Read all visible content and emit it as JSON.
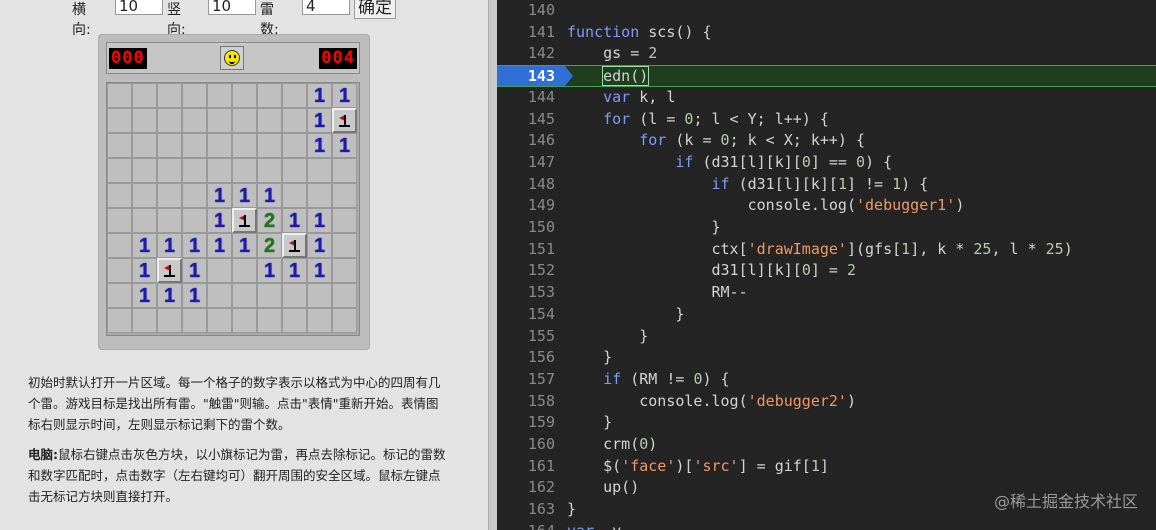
{
  "settings": {
    "width_label": "横向:",
    "width_value": "10",
    "height_label": "竖向:",
    "height_value": "10",
    "mines_label": "雷数:",
    "mines_value": "4",
    "confirm_label": "确定"
  },
  "game": {
    "mines_left": "000",
    "timer": "004",
    "grid": [
      [
        "",
        "",
        "",
        "",
        "",
        "",
        "",
        "",
        "1",
        "1"
      ],
      [
        "",
        "",
        "",
        "",
        "",
        "",
        "",
        "",
        "1",
        "F"
      ],
      [
        "",
        "",
        "",
        "",
        "",
        "",
        "",
        "",
        "1",
        "1"
      ],
      [
        "",
        "",
        "",
        "",
        "",
        "",
        "",
        "",
        "",
        ""
      ],
      [
        "",
        "",
        "",
        "",
        "1",
        "1",
        "1",
        "",
        "",
        ""
      ],
      [
        "",
        "",
        "",
        "",
        "1",
        "F",
        "2",
        "1",
        "1",
        ""
      ],
      [
        "",
        "1",
        "1",
        "1",
        "1",
        "1",
        "2",
        "F",
        "1",
        ""
      ],
      [
        "",
        "1",
        "F",
        "1",
        "",
        "",
        "1",
        "1",
        "1",
        ""
      ],
      [
        "",
        "1",
        "1",
        "1",
        "",
        "",
        "",
        "",
        "",
        ""
      ],
      [
        "",
        "",
        "",
        "",
        "",
        "",
        "",
        "",
        "",
        ""
      ]
    ]
  },
  "description": {
    "p1": "初始时默认打开一片区域。每一个格子的数字表示以格式为中心的四周有几个雷。游戏目标是找出所有雷。\"触雷\"则输。点击\"表情\"重新开始。表情图标右则显示时间，左则显示标记剩下的雷个数。",
    "p2_bold": "电脑:",
    "p2": "鼠标右键点击灰色方块，以小旗标记为雷，再点去除标记。标记的雷数和数字匹配时，点击数字（左右键均可）翻开周围的安全区域。鼠标左键点击无标记方块则直接打开。"
  },
  "code": {
    "active_line": 143,
    "lines": [
      {
        "n": "140",
        "t": ""
      },
      {
        "n": "141",
        "t": "function scs() {"
      },
      {
        "n": "142",
        "t": "    gs = 2"
      },
      {
        "n": "143",
        "t": "    edn()"
      },
      {
        "n": "144",
        "t": "    var k, l"
      },
      {
        "n": "145",
        "t": "    for (l = 0; l < Y; l++) {"
      },
      {
        "n": "146",
        "t": "        for (k = 0; k < X; k++) {"
      },
      {
        "n": "147",
        "t": "            if (d31[l][k][0] == 0) {"
      },
      {
        "n": "148",
        "t": "                if (d31[l][k][1] != 1) {"
      },
      {
        "n": "149",
        "t": "                    console.log('debugger1')"
      },
      {
        "n": "150",
        "t": "                }"
      },
      {
        "n": "151",
        "t": "                ctx['drawImage'](gfs[1], k * 25, l * 25)"
      },
      {
        "n": "152",
        "t": "                d31[l][k][0] = 2"
      },
      {
        "n": "153",
        "t": "                RM--"
      },
      {
        "n": "154",
        "t": "            }"
      },
      {
        "n": "155",
        "t": "        }"
      },
      {
        "n": "156",
        "t": "    }"
      },
      {
        "n": "157",
        "t": "    if (RM != 0) {"
      },
      {
        "n": "158",
        "t": "        console.log('debugger2')"
      },
      {
        "n": "159",
        "t": "    }"
      },
      {
        "n": "160",
        "t": "    crm(0)"
      },
      {
        "n": "161",
        "t": "    $('face')['src'] = gif[1]"
      },
      {
        "n": "162",
        "t": "    up()"
      },
      {
        "n": "163",
        "t": "}"
      },
      {
        "n": "164",
        "t": "var  y"
      }
    ]
  },
  "watermark": "@稀土掘金技术社区"
}
